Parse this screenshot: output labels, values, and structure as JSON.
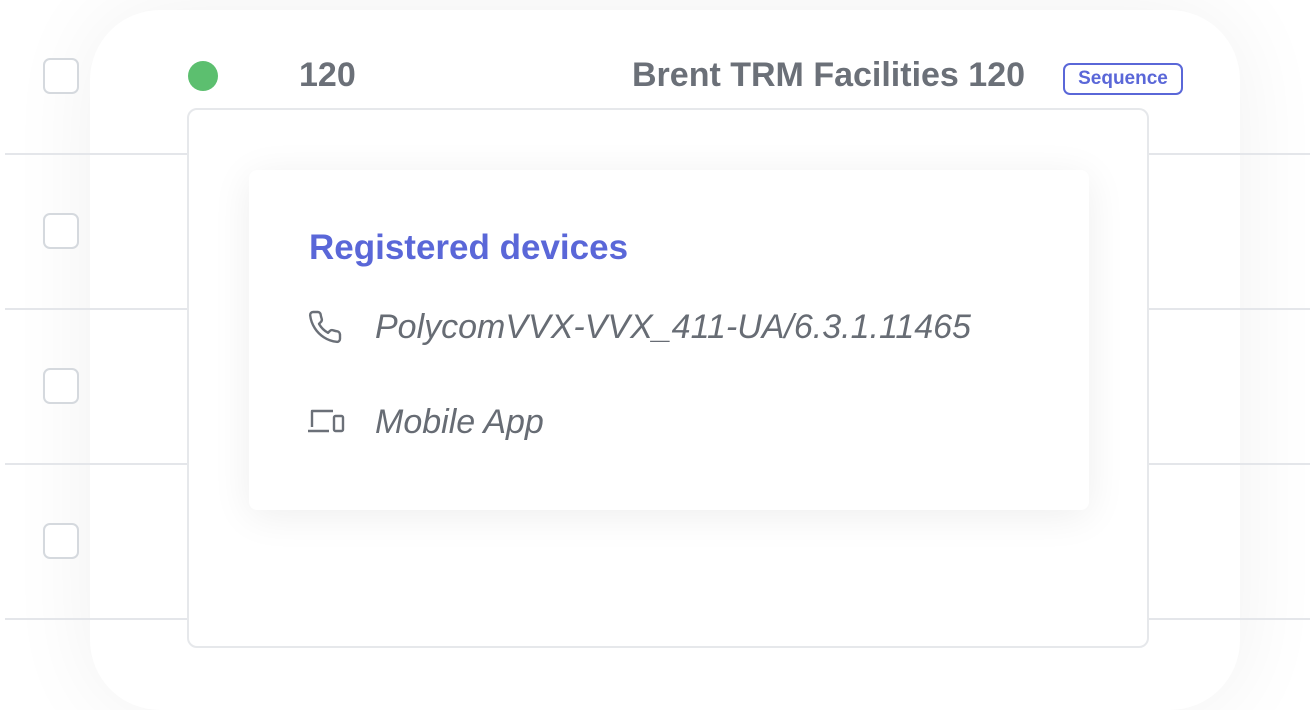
{
  "row": {
    "extension": "120",
    "name": "Brent TRM Facilities 120",
    "badge": "Sequence",
    "status_color": "#5cbf6f"
  },
  "popover": {
    "title": "Registered devices",
    "devices": [
      {
        "icon": "phone-icon",
        "label": "PolycomVVX-VVX_411-UA/6.3.1.11465"
      },
      {
        "icon": "devices-icon",
        "label": "Mobile App"
      }
    ]
  },
  "colors": {
    "accent": "#5a67d8",
    "text": "#6b7078",
    "border": "#e4e6ea"
  }
}
